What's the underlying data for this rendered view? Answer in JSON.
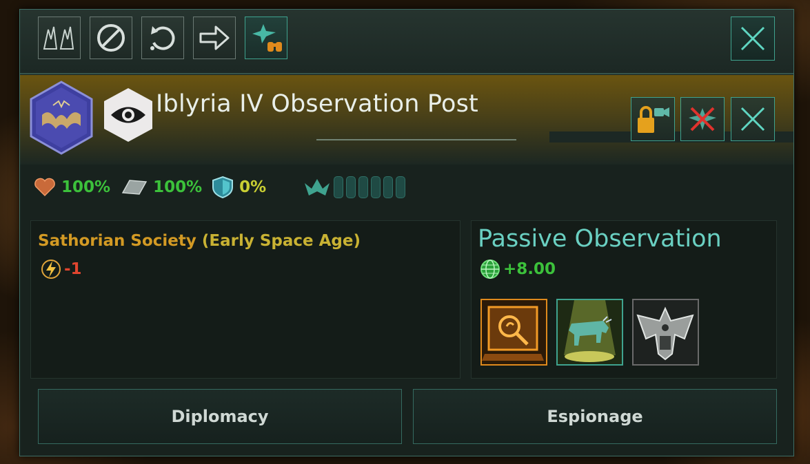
{
  "toolbar": {
    "buttons": [
      {
        "icon": "fleet-formation-icon"
      },
      {
        "icon": "cancel-icon"
      },
      {
        "icon": "return-icon"
      },
      {
        "icon": "move-arrow-icon"
      },
      {
        "icon": "observation-station-binoculars-icon"
      }
    ],
    "close_icon": "close-icon"
  },
  "header": {
    "title": "Iblyria IV Observation Post",
    "emblem_icon": "sathorian-empire-emblem-icon",
    "type_icon": "eye-icon",
    "buttons": [
      {
        "icon": "lock-camera-icon"
      },
      {
        "icon": "disband-ship-icon"
      },
      {
        "icon": "close-icon"
      }
    ]
  },
  "stats": {
    "hull": "100%",
    "armor": "100%",
    "shields": "0%",
    "fleet_pips": 6
  },
  "left_box": {
    "society_name": "Sathorian Society",
    "society_age": "(Early Space Age)",
    "energy_value": "-1"
  },
  "right_box": {
    "title": "Passive Observation",
    "society_research": "+8.00",
    "modifiers": [
      {
        "icon": "research-terminal-icon",
        "highlight": "#e08a1c"
      },
      {
        "icon": "livestock-abduction-icon",
        "highlight": "#3fa38f"
      },
      {
        "icon": "alien-ship-icon",
        "highlight": "#8a8a8a"
      }
    ]
  },
  "actions": {
    "diplomacy": "Diplomacy",
    "espionage": "Espionage"
  },
  "colors": {
    "accent": "#3fa38f",
    "gold": "#d39a24",
    "positive": "#3cc13b",
    "negative": "#e0452f"
  }
}
